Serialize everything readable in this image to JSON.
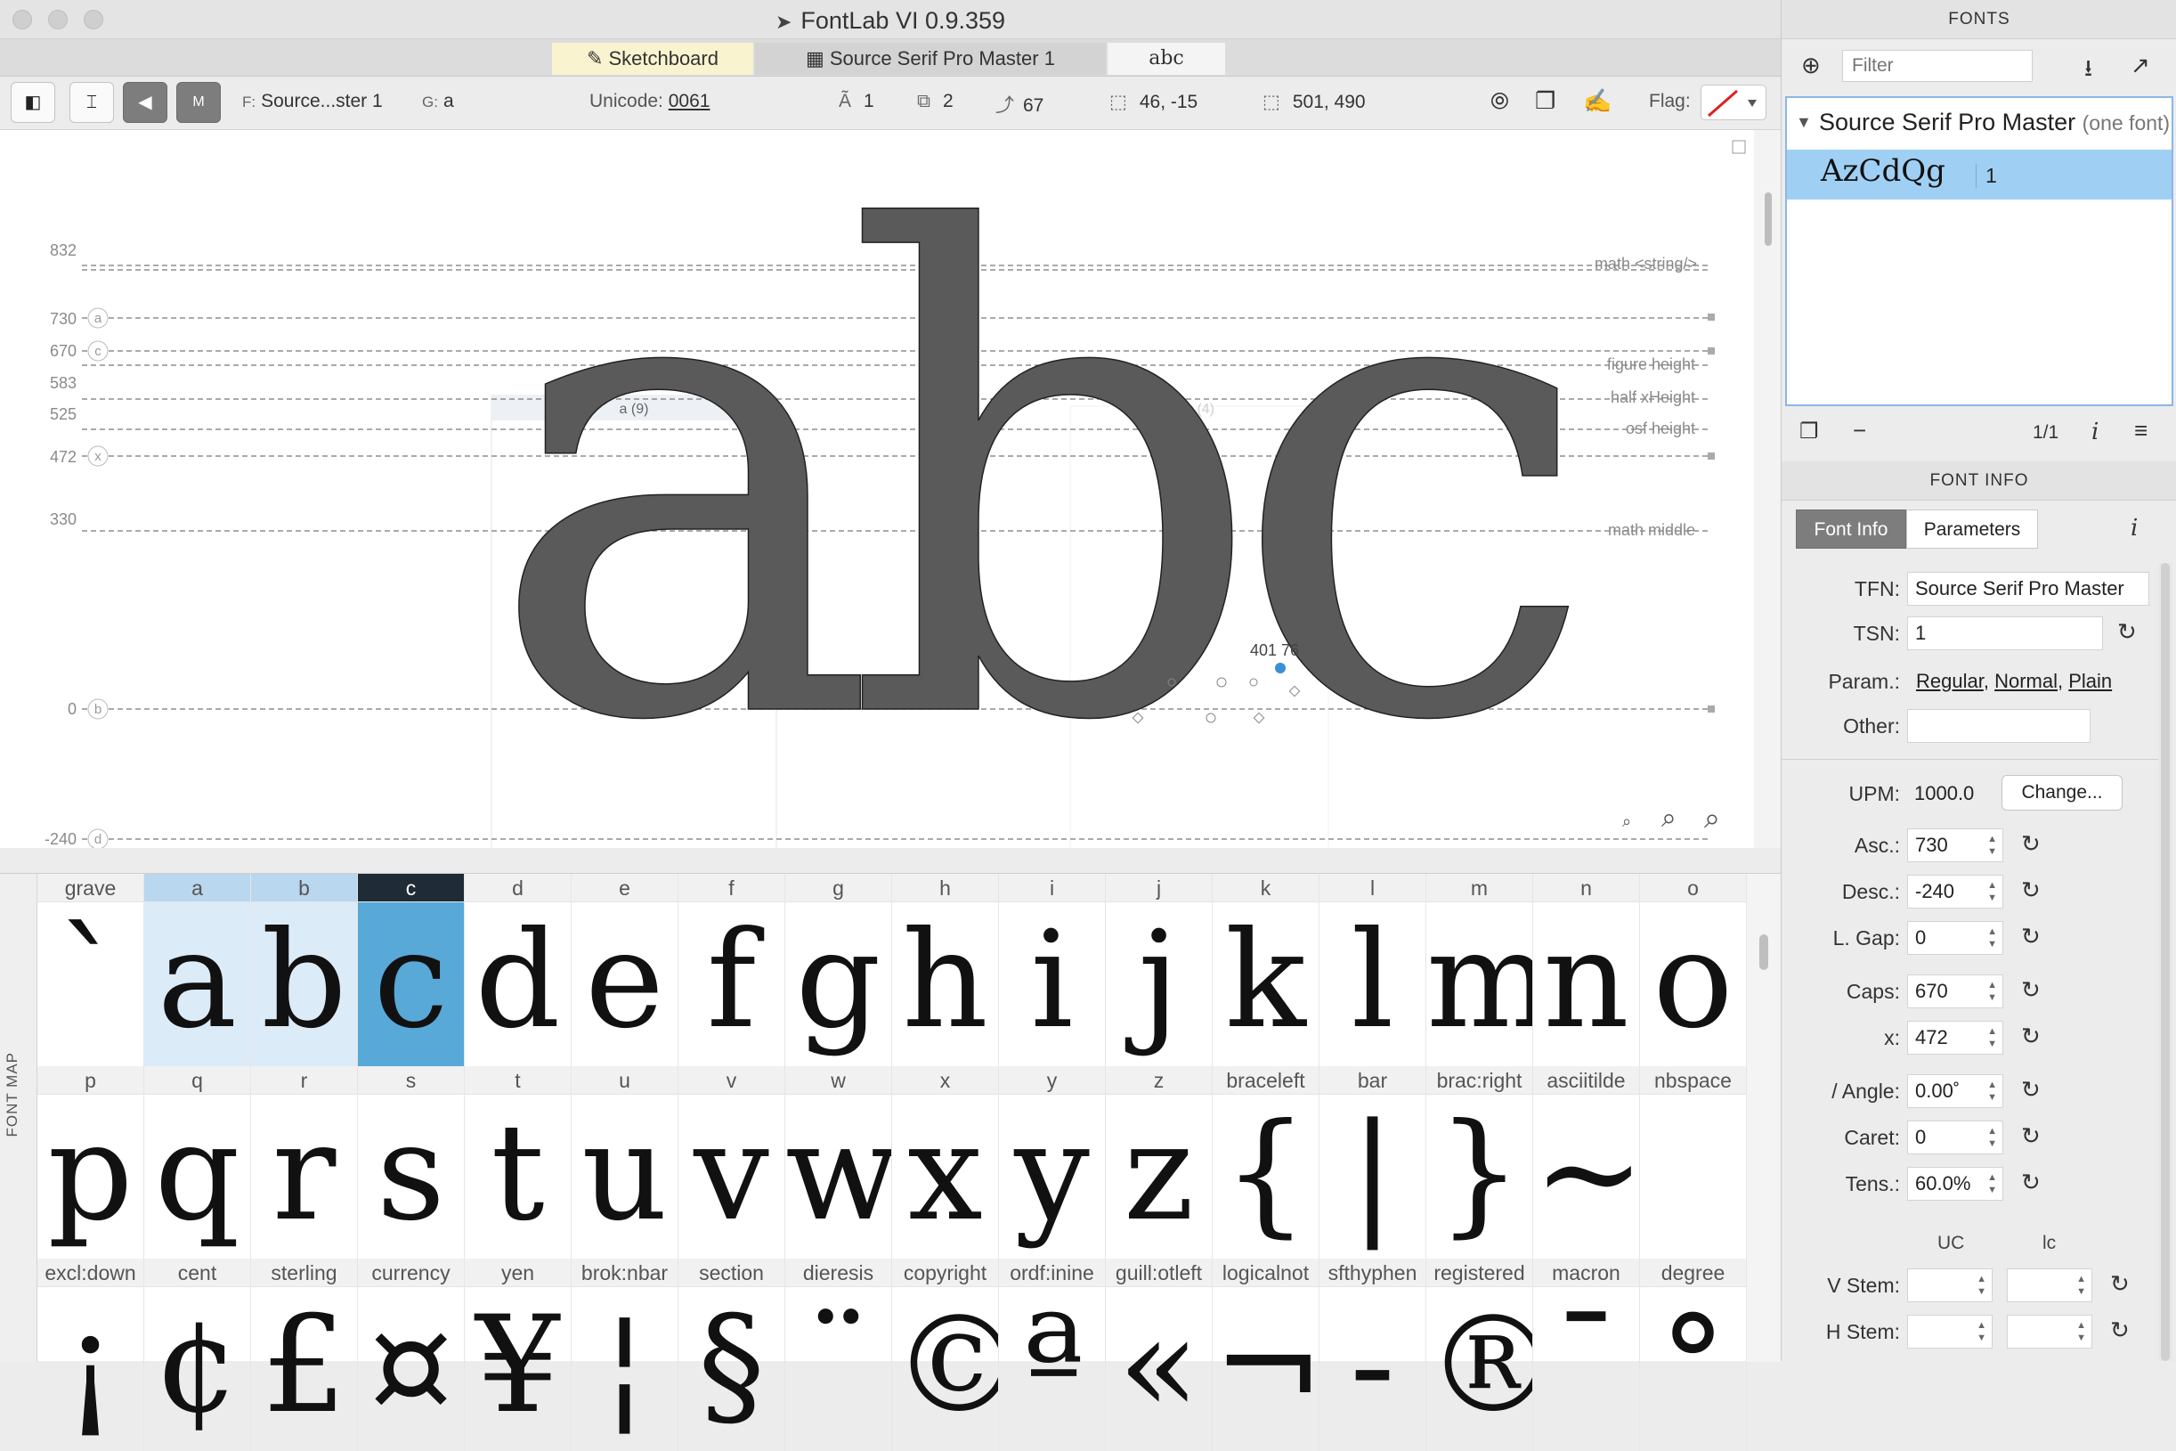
{
  "window": {
    "title": "FontLab VI 0.9.359"
  },
  "tabs": [
    {
      "label": "Sketchboard",
      "icon": "pen-icon"
    },
    {
      "label": "Source Serif Pro Master 1",
      "icon": "grid-icon"
    },
    {
      "label": "abc"
    }
  ],
  "toolbar": {
    "font_key": "F:",
    "font_value": "Source...ster 1",
    "glyph_key": "G:",
    "glyph_value": "a",
    "unicode_label": "Unicode:",
    "unicode_value": "0061",
    "layers_value": "1",
    "contours_value": "2",
    "nodes_value": "67",
    "coord_value": "46, -15",
    "size_value": "501, 490",
    "flag_label": "Flag:",
    "flag_color": "#e02020"
  },
  "canvas": {
    "guides": [
      {
        "value": "832",
        "badge": "",
        "label": "math <string/>"
      },
      {
        "value": "730",
        "badge": "a",
        "label": ""
      },
      {
        "value": "670",
        "badge": "c",
        "label": ""
      },
      {
        "value": "583",
        "badge": "",
        "label": "figure height"
      },
      {
        "value": "525",
        "badge": "",
        "label": "half xHeight"
      },
      {
        "value": "472",
        "badge": "x",
        "label": "osf height"
      },
      {
        "value": "330",
        "badge": "",
        "label": "math middle"
      },
      {
        "value": "0",
        "badge": "b",
        "label": ""
      },
      {
        "value": "-240",
        "badge": "d",
        "label": ""
      }
    ],
    "glyph_a_label": "a (9)",
    "glyph_c_label": "c (4)",
    "text": "abc",
    "coord_readout": "401  76"
  },
  "fontmap": {
    "label": "FONT MAP",
    "rows": [
      [
        {
          "name": "grave",
          "glyph": "`"
        },
        {
          "name": "a",
          "glyph": "a"
        },
        {
          "name": "b",
          "glyph": "b"
        },
        {
          "name": "c",
          "glyph": "c"
        },
        {
          "name": "d",
          "glyph": "d"
        },
        {
          "name": "e",
          "glyph": "e"
        },
        {
          "name": "f",
          "glyph": "f"
        },
        {
          "name": "g",
          "glyph": "g"
        },
        {
          "name": "h",
          "glyph": "h"
        },
        {
          "name": "i",
          "glyph": "i"
        },
        {
          "name": "j",
          "glyph": "j"
        },
        {
          "name": "k",
          "glyph": "k"
        },
        {
          "name": "l",
          "glyph": "l"
        },
        {
          "name": "m",
          "glyph": "m"
        },
        {
          "name": "n",
          "glyph": "n"
        },
        {
          "name": "o",
          "glyph": "o"
        }
      ],
      [
        {
          "name": "p",
          "glyph": "p"
        },
        {
          "name": "q",
          "glyph": "q"
        },
        {
          "name": "r",
          "glyph": "r"
        },
        {
          "name": "s",
          "glyph": "s"
        },
        {
          "name": "t",
          "glyph": "t"
        },
        {
          "name": "u",
          "glyph": "u"
        },
        {
          "name": "v",
          "glyph": "v"
        },
        {
          "name": "w",
          "glyph": "w"
        },
        {
          "name": "x",
          "glyph": "x"
        },
        {
          "name": "y",
          "glyph": "y"
        },
        {
          "name": "z",
          "glyph": "z"
        },
        {
          "name": "braceleft",
          "glyph": "{"
        },
        {
          "name": "bar",
          "glyph": "|"
        },
        {
          "name": "brac:right",
          "glyph": "}"
        },
        {
          "name": "asciitilde",
          "glyph": "~"
        },
        {
          "name": "nbspace",
          "glyph": ""
        }
      ],
      [
        {
          "name": "excl:down",
          "glyph": "¡"
        },
        {
          "name": "cent",
          "glyph": "¢"
        },
        {
          "name": "sterling",
          "glyph": "£"
        },
        {
          "name": "currency",
          "glyph": "¤"
        },
        {
          "name": "yen",
          "glyph": "¥"
        },
        {
          "name": "brok:nbar",
          "glyph": "¦"
        },
        {
          "name": "section",
          "glyph": "§"
        },
        {
          "name": "dieresis",
          "glyph": "¨"
        },
        {
          "name": "copyright",
          "glyph": "©"
        },
        {
          "name": "ordf:inine",
          "glyph": "ª"
        },
        {
          "name": "guill:otleft",
          "glyph": "«"
        },
        {
          "name": "logicalnot",
          "glyph": "¬"
        },
        {
          "name": "sfthyphen",
          "glyph": "-"
        },
        {
          "name": "registered",
          "glyph": "®"
        },
        {
          "name": "macron",
          "glyph": "¯"
        },
        {
          "name": "degree",
          "glyph": "°"
        }
      ]
    ]
  },
  "panel": {
    "fonts_header": "FONTS",
    "filter_placeholder": "Filter",
    "font_family": "Source Serif Pro Master",
    "font_family_note": "(one font)",
    "sample": "AzCdQg",
    "font_index": "1",
    "count": "1/1",
    "font_info_header": "FONT INFO",
    "tab_font_info": "Font Info",
    "tab_parameters": "Parameters",
    "tfn_label": "TFN:",
    "tfn_value": "Source Serif Pro Master",
    "tsn_label": "TSN:",
    "tsn_value": "1",
    "param_label": "Param.:",
    "param_1": "Regular",
    "param_2": "Normal",
    "param_3": "Plain",
    "other_label": "Other:",
    "upm_label": "UPM:",
    "upm_value": "1000.0",
    "change_label": "Change...",
    "asc_label": "Asc.:",
    "asc_value": "730",
    "desc_label": "Desc.:",
    "desc_value": "-240",
    "lgap_label": "L. Gap:",
    "lgap_value": "0",
    "caps_label": "Caps:",
    "caps_value": "670",
    "x_label": "x:",
    "x_value": "472",
    "angle_label": "/ Angle:",
    "angle_value": "0.00˚",
    "caret_label": "Caret:",
    "caret_value": "0",
    "tens_label": "Tens.:",
    "tens_value": "60.0%",
    "uc_label": "UC",
    "lc_label": "lc",
    "vstem_label": "V Stem:",
    "hstem_label": "H Stem:"
  }
}
